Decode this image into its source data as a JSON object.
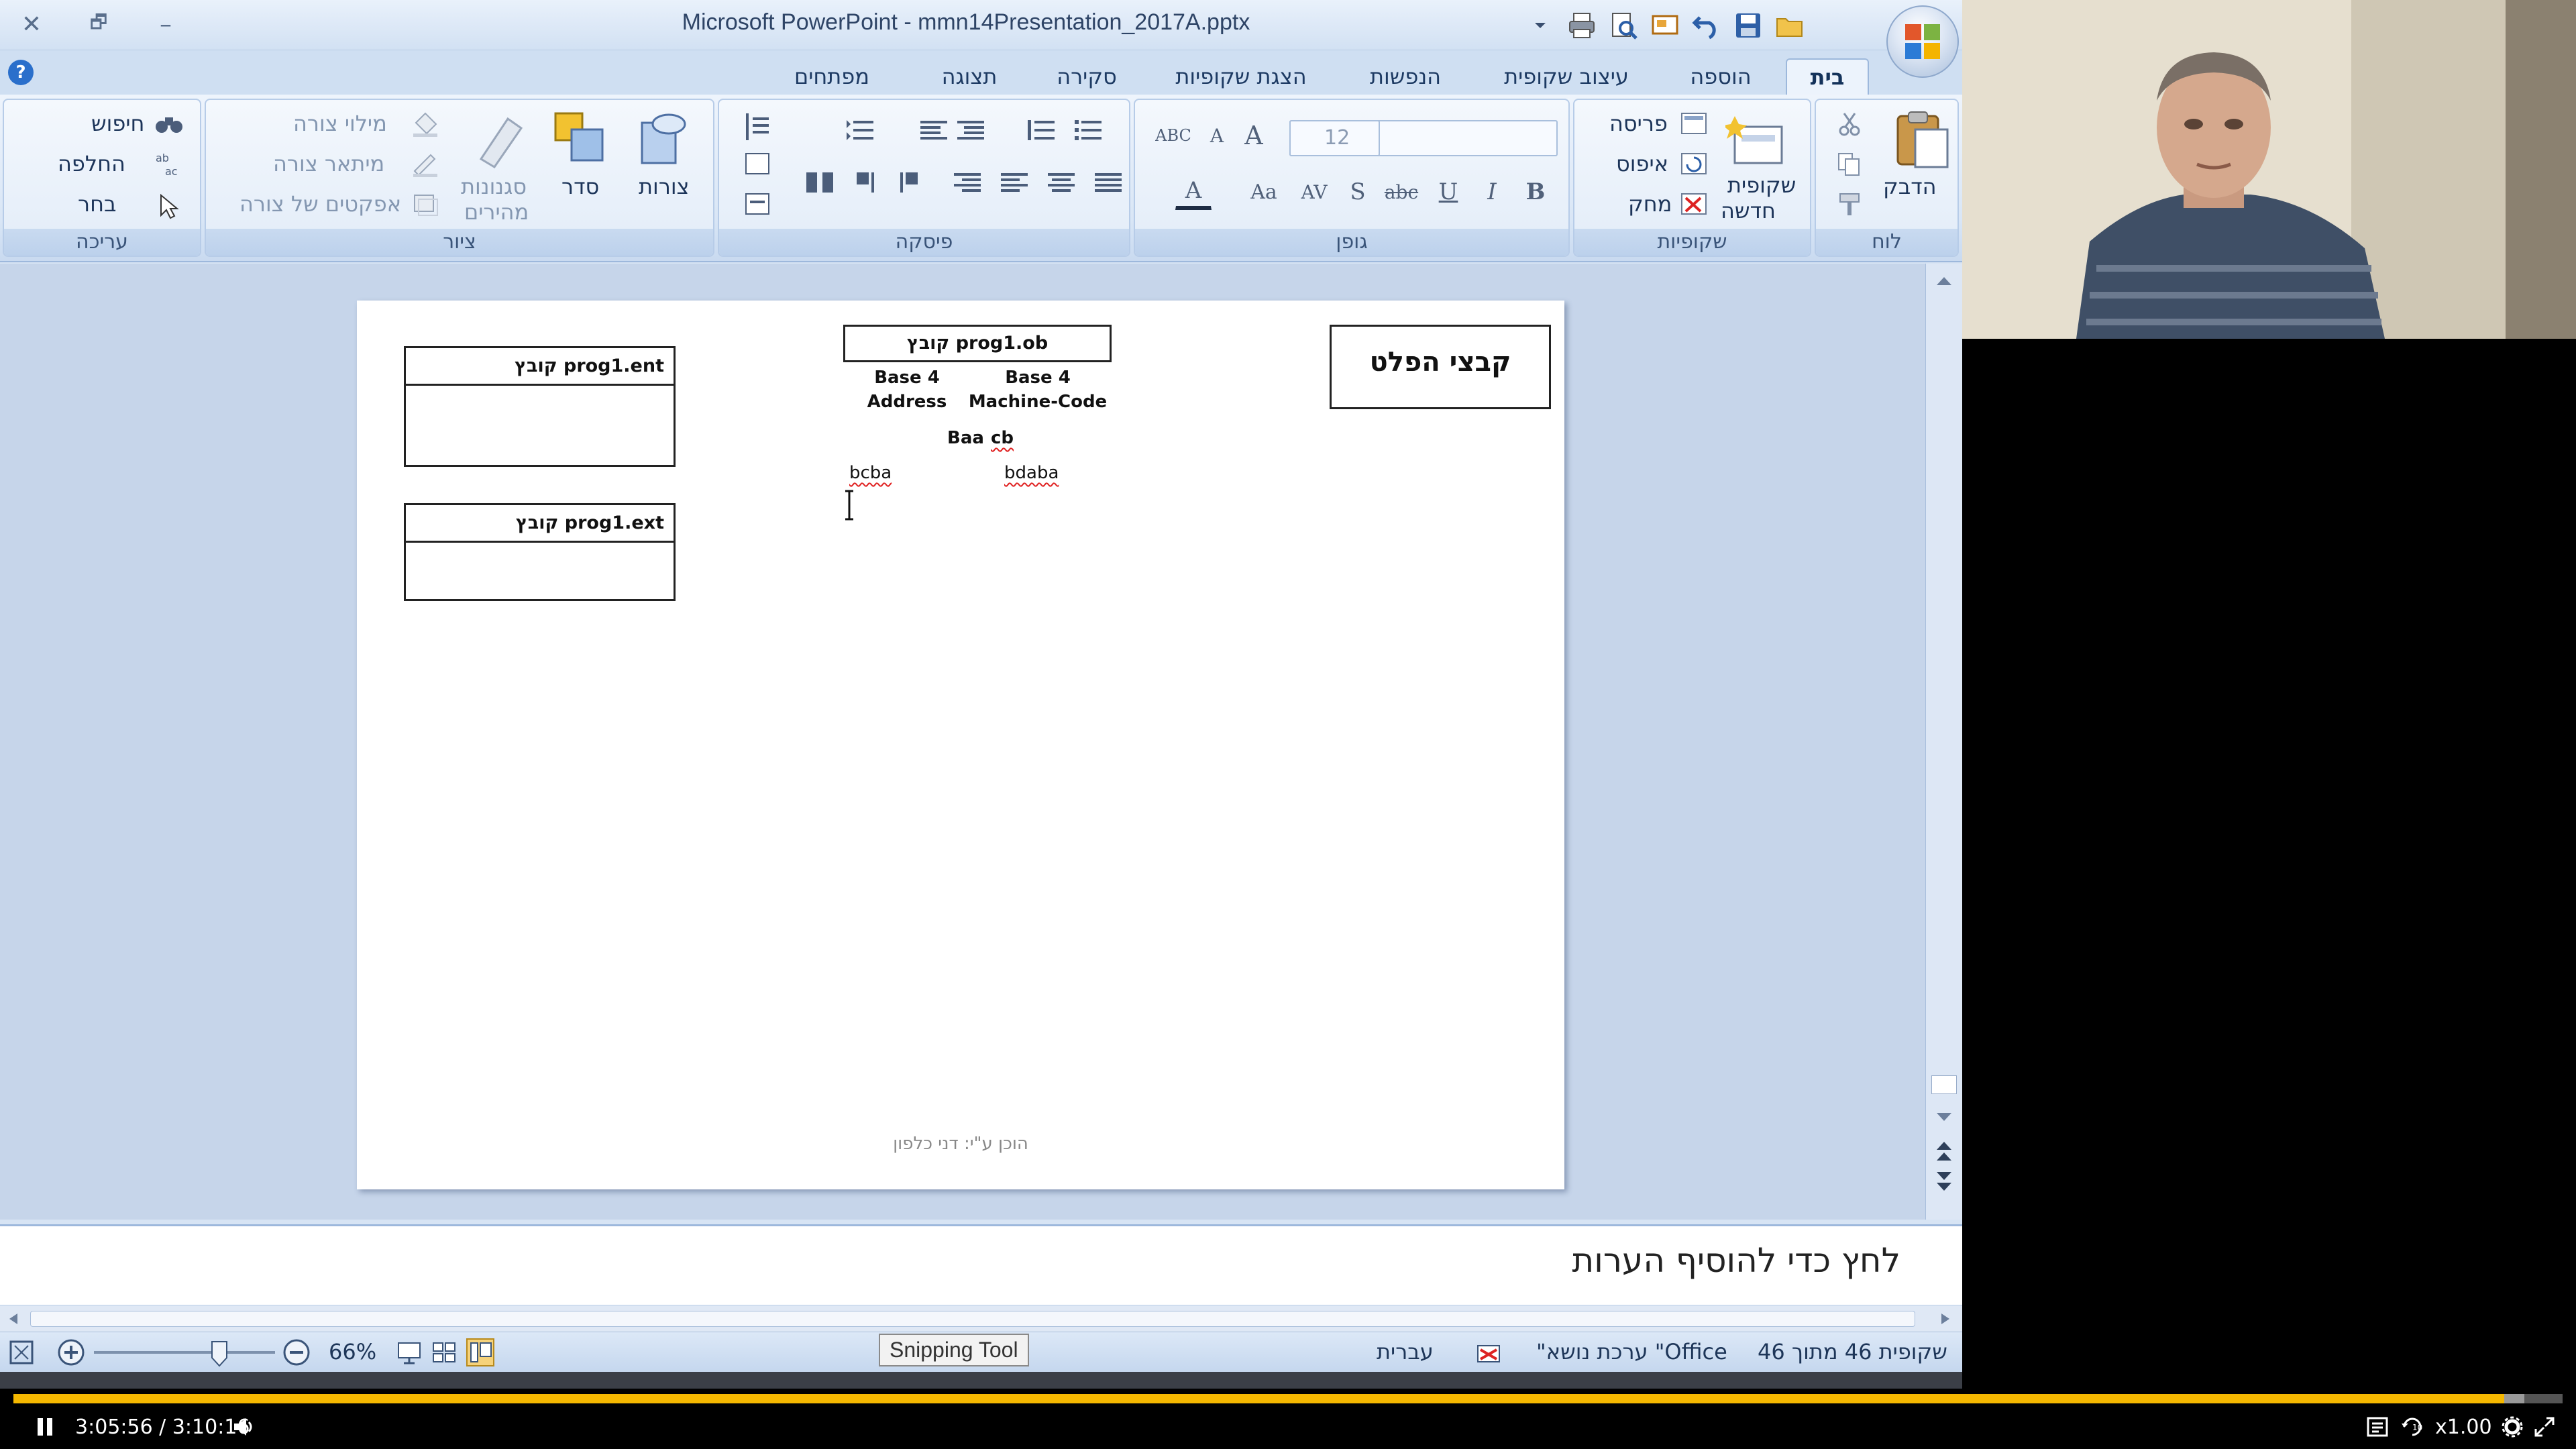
{
  "window": {
    "title": "Microsoft PowerPoint - mmn14Presentation_2017A.pptx",
    "close_glyph": "✕",
    "restore_glyph": "🗗",
    "minimize_glyph": "–"
  },
  "help_glyph": "?",
  "tabs": [
    "בית",
    "הוספה",
    "עיצוב שקופית",
    "הנפשות",
    "הצגת שקופיות",
    "סקירה",
    "תצוגה",
    "מפתחים"
  ],
  "ribbon": {
    "groups": {
      "clipboard": {
        "label": "לוח",
        "paste": "הדבק"
      },
      "slides": {
        "label": "שקופיות",
        "new_slide_line1": "שקופית",
        "new_slide_line2": "חדשה",
        "layout": "פריסה",
        "reset": "איפוס",
        "delete": "מחק"
      },
      "font": {
        "label": "גופן",
        "font_size": "12",
        "bold": "B",
        "italic": "I",
        "underline": "U",
        "strike": "abc",
        "shadow": "S",
        "spacing": "AV",
        "case": "Aa",
        "grow": "A",
        "shrink": "A",
        "color": "A"
      },
      "paragraph": {
        "label": "פיסקה"
      },
      "drawing": {
        "label": "ציור",
        "shapes": "צורות",
        "arrange": "סדר",
        "quick_styles_line1": "סגנונות",
        "quick_styles_line2": "מהירים",
        "fill": "מילוי צורה",
        "outline": "מיתאר צורה",
        "effects": "אפקטים של צורה"
      },
      "editing": {
        "label": "עריכה",
        "find": "חיפוש",
        "replace": "החלפה",
        "select": "בחר"
      }
    }
  },
  "slide": {
    "title": "קבצי הפלט",
    "ob_box_title": "קובץ prog1.ob",
    "col1_line1": "Base 4",
    "col1_line2": "Address",
    "col2_line1": "Base 4",
    "col2_line2": "Machine-Code",
    "header_row_a": "Baa",
    "header_row_b": "cb",
    "row1_address": "bcba",
    "row1_code": "bdaba",
    "ent_box_title": "קובץ prog1.ent",
    "ext_box_title": "קובץ prog1.ext",
    "footer": "הוכן ע\"י: דני כלפון"
  },
  "notes_placeholder": "לחץ כדי להוסיף הערות",
  "status": {
    "slide_counter": "שקופית 46 מתוך 46",
    "theme": "\"ערכת נושא \"Office",
    "language": "עברית",
    "zoom": "66%"
  },
  "tooltip": "Snipping Tool",
  "player": {
    "time": "3:05:56 / 3:10:16",
    "speed": "x1.00",
    "progress": 0.977,
    "buffered": 0.985
  },
  "colors": {
    "progress": "#f5b800",
    "ribbon_bg": "#d9e6f6",
    "workspace_bg": "#c6d5ea"
  }
}
